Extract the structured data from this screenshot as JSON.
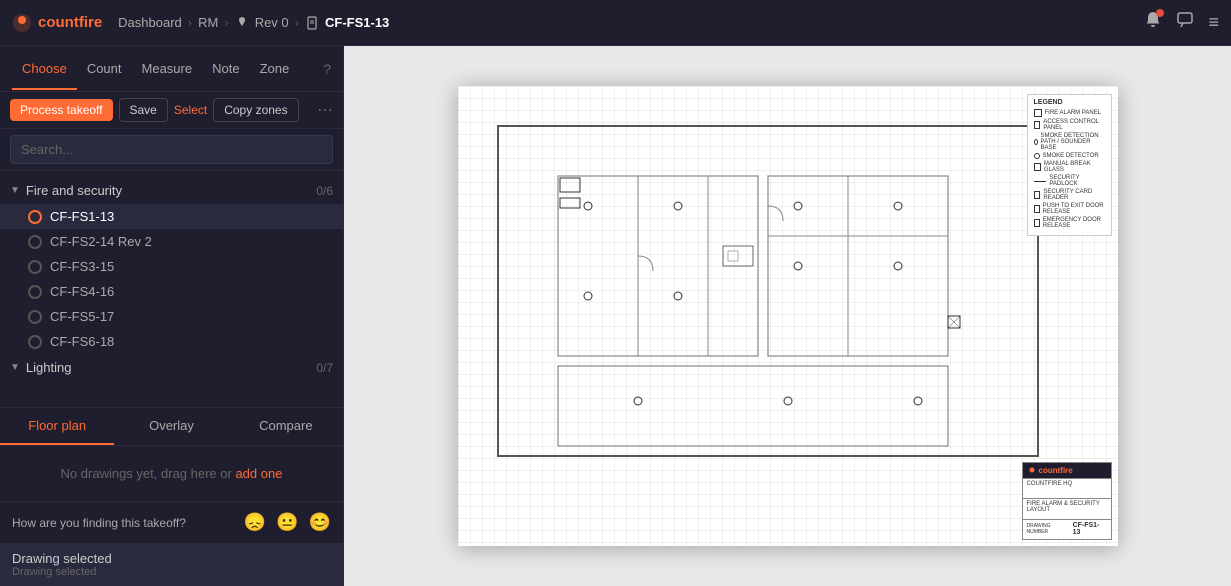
{
  "topbar": {
    "logo_text": "countfire",
    "breadcrumb": [
      {
        "label": "Dashboard",
        "sep": "›"
      },
      {
        "label": "RM",
        "sep": "›"
      },
      {
        "label": "Rev 0",
        "icon": "pin",
        "sep": "›"
      },
      {
        "label": "CF-FS1-13",
        "icon": "doc",
        "current": true
      }
    ],
    "notification_label": "notifications",
    "comment_label": "comments",
    "menu_label": "menu"
  },
  "tabs": [
    {
      "label": "Choose",
      "active": true
    },
    {
      "label": "Count"
    },
    {
      "label": "Measure"
    },
    {
      "label": "Note"
    },
    {
      "label": "Zone"
    },
    {
      "label": "?"
    }
  ],
  "actions": {
    "process": "Process takeoff",
    "save": "Save",
    "select": "Select",
    "copy": "Copy zones",
    "more": "⋯"
  },
  "search": {
    "placeholder": "Search..."
  },
  "tree": {
    "groups": [
      {
        "label": "Fire and security",
        "count": "0/6",
        "expanded": true,
        "items": [
          {
            "label": "CF-FS1-13",
            "active": true
          },
          {
            "label": "CF-FS2-14 Rev 2"
          },
          {
            "label": "CF-FS3-15"
          },
          {
            "label": "CF-FS4-16"
          },
          {
            "label": "CF-FS5-17"
          },
          {
            "label": "CF-FS6-18"
          }
        ]
      },
      {
        "label": "Lighting",
        "count": "0/7",
        "expanded": false,
        "items": []
      }
    ]
  },
  "bottom_tabs": [
    {
      "label": "Floor plan",
      "active": true
    },
    {
      "label": "Overlay"
    },
    {
      "label": "Compare"
    }
  ],
  "no_drawings": {
    "text": "No drawings yet, drag here or",
    "link": "add one"
  },
  "feedback": {
    "question": "How are you finding this takeoff?",
    "emojis": [
      "😞",
      "😐",
      "😊"
    ]
  },
  "status": {
    "primary": "Drawing selected",
    "secondary": "Drawing selected"
  },
  "legend": {
    "title": "LEGEND",
    "items": [
      {
        "type": "sq",
        "label": "FIRE ALARM PANEL"
      },
      {
        "type": "sq",
        "label": "ACCESS CONTROL PANEL"
      },
      {
        "type": "dot",
        "label": "SMOKE DETECTION PATH / SOUNDER BASE"
      },
      {
        "type": "dot",
        "label": "SMOKE DETECTOR"
      },
      {
        "type": "sq",
        "label": "MANUAL BREAK GLASS"
      },
      {
        "type": "line",
        "label": "SECURITY PADLOCK"
      },
      {
        "type": "sq",
        "label": "SECURITY CARD READER"
      },
      {
        "type": "sq",
        "label": "PUSH TO EXIT DOOR RELEASE"
      },
      {
        "type": "sq",
        "label": "EMERGENCY DOOR RELEASE"
      }
    ]
  },
  "title_block": {
    "company": "countfire",
    "project": "COUNTFIRE HQ",
    "description": "FIRE ALARM & SECURITY LAYOUT",
    "drawing_number": "CF-FS1-13"
  }
}
